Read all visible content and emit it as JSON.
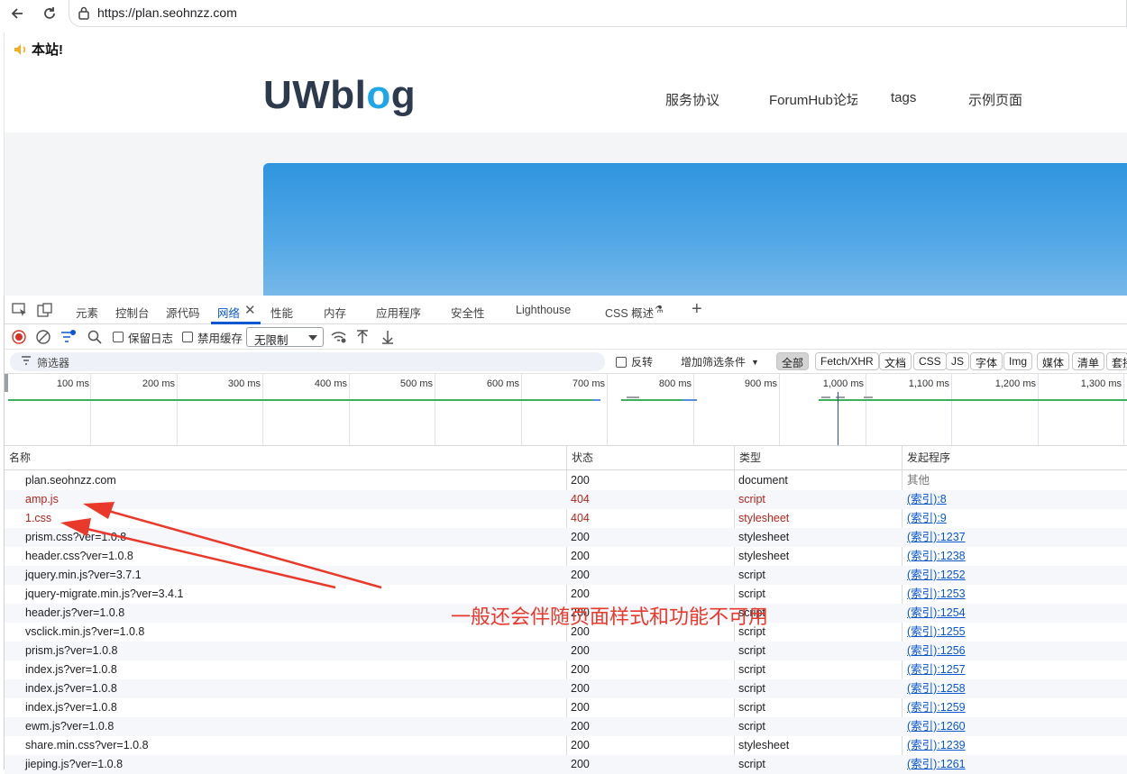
{
  "browser": {
    "url": "https://plan.seohnzz.com",
    "back_icon": "arrow-left-icon",
    "reload_icon": "reload-icon",
    "lock_icon": "lock-icon"
  },
  "page": {
    "notice": "本站!",
    "logo_main": "UWbl",
    "logo_accent": "o",
    "logo_tail": "g",
    "menu": [
      "服务协议",
      "ForumHub论坛",
      "tags",
      "示例页面"
    ]
  },
  "devtools": {
    "tabs": [
      "元素",
      "控制台",
      "源代码",
      "网络",
      "性能",
      "内存",
      "应用程序",
      "安全性",
      "Lighthouse",
      "CSS 概述"
    ],
    "active_tab": "网络",
    "toolbar": {
      "preserve_log": "保留日志",
      "disable_cache": "禁用缓存",
      "throttle": "无限制"
    },
    "filter": {
      "placeholder": "筛选器",
      "invert": "反转",
      "more_filters": "增加筛选条件",
      "chips": [
        "全部",
        "Fetch/XHR",
        "文档",
        "CSS",
        "JS",
        "字体",
        "Img",
        "媒体",
        "清单",
        "套接"
      ]
    },
    "timeline_labels": [
      "100 ms",
      "200 ms",
      "300 ms",
      "400 ms",
      "500 ms",
      "600 ms",
      "700 ms",
      "800 ms",
      "900 ms",
      "1,000 ms",
      "1,100 ms",
      "1,200 ms",
      "1,300 ms"
    ],
    "columns": [
      "名称",
      "状态",
      "类型",
      "发起程序"
    ],
    "requests": [
      {
        "name": "plan.seohnzz.com",
        "status": "200",
        "type": "document",
        "initiator": "其他"
      },
      {
        "name": "amp.js",
        "status": "404",
        "type": "script",
        "initiator": "(索引):8"
      },
      {
        "name": "1.css",
        "status": "404",
        "type": "stylesheet",
        "initiator": "(索引):9"
      },
      {
        "name": "prism.css?ver=1.0.8",
        "status": "200",
        "type": "stylesheet",
        "initiator": "(索引):1237"
      },
      {
        "name": "header.css?ver=1.0.8",
        "status": "200",
        "type": "stylesheet",
        "initiator": "(索引):1238"
      },
      {
        "name": "jquery.min.js?ver=3.7.1",
        "status": "200",
        "type": "script",
        "initiator": "(索引):1252"
      },
      {
        "name": "jquery-migrate.min.js?ver=3.4.1",
        "status": "200",
        "type": "script",
        "initiator": "(索引):1253"
      },
      {
        "name": "header.js?ver=1.0.8",
        "status": "200",
        "type": "script",
        "initiator": "(索引):1254"
      },
      {
        "name": "vsclick.min.js?ver=1.0.8",
        "status": "200",
        "type": "script",
        "initiator": "(索引):1255"
      },
      {
        "name": "prism.js?ver=1.0.8",
        "status": "200",
        "type": "script",
        "initiator": "(索引):1256"
      },
      {
        "name": "index.js?ver=1.0.8",
        "status": "200",
        "type": "script",
        "initiator": "(索引):1257"
      },
      {
        "name": "index.js?ver=1.0.8",
        "status": "200",
        "type": "script",
        "initiator": "(索引):1258"
      },
      {
        "name": "index.js?ver=1.0.8",
        "status": "200",
        "type": "script",
        "initiator": "(索引):1259"
      },
      {
        "name": "ewm.js?ver=1.0.8",
        "status": "200",
        "type": "script",
        "initiator": "(索引):1260"
      },
      {
        "name": "share.min.css?ver=1.0.8",
        "status": "200",
        "type": "stylesheet",
        "initiator": "(索引):1239"
      },
      {
        "name": "jieping.js?ver=1.0.8",
        "status": "200",
        "type": "script",
        "initiator": "(索引):1261"
      }
    ]
  },
  "annotation": {
    "text": "一般还会伴随页面样式和功能不可用",
    "color": "#e8392b"
  },
  "colors": {
    "accent": "#0b57d0",
    "error": "#b3261e",
    "logo": "#2d3a4d",
    "logo_accent": "#1fa6e8"
  }
}
